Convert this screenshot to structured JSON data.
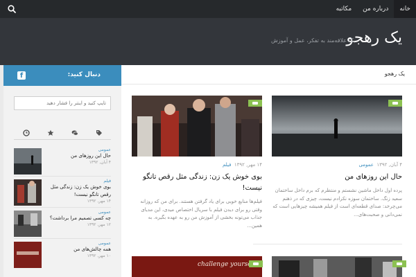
{
  "topnav": {
    "items": [
      {
        "label": "خانه"
      },
      {
        "label": "درباره من"
      },
      {
        "label": "مکاتبه"
      }
    ]
  },
  "header": {
    "title": "یک رهجو",
    "description": "یک علاقه‌مند به تفکر، عمل و آموزش"
  },
  "sidebar": {
    "follow_title": "دنبال کنید:",
    "search_placeholder": "تایپ کنید و اینتر را فشار دهید",
    "tabs": [
      "clock-icon",
      "star-icon",
      "comments-icon",
      "tags-icon"
    ],
    "items": [
      {
        "category": "عمومی",
        "title": "حال این روزهای من",
        "date": "۴ آبان, ۱۳۹۲"
      },
      {
        "category": "فیلم",
        "title": "بوی خوش یک زن: زندگی مثل رقص تانگو نیست!",
        "date": "۱۴ مهر, ۱۳۹۲"
      },
      {
        "category": "عمومی",
        "title": "چه کسی تصمیم مرا برداشت؟",
        "date": "۱۲ مهر, ۱۳۹۲"
      },
      {
        "category": "عمومی",
        "title": "همه چالش‌های من",
        "date": "۱۰ مهر, ۱۳۹۲"
      }
    ]
  },
  "main": {
    "breadcrumb": "یک رهجو",
    "posts": [
      {
        "date": "۴ آبان, ۱۳۹۲",
        "category": "عمومی",
        "title": "حال این روزهای من",
        "excerpt": "پرده اول داخل ماشین نشستم و منتظرم که برم داخل ساختمان سعید زنگ. ساختمان سوزه نکرادم نیست، چیزی که در ذهنم می‌چرخد: صدای قطعه‌ای است از فیلم همیشه چیزهایی است که نمی‌دانی و صحبت‌های..."
      },
      {
        "date": "۱۴ مهر, ۱۳۹۲",
        "category": "فیلم",
        "title": "بوی خوش یک زن: زندگی مثل رقص تانگو نیست!",
        "excerpt": "فیلم‌ها منابع خوبی برای یاد گرفتن هستند. برای من که روزانه وقتی رو برای دیدن فیلم با سریال اختصاص میدی، این مدیای جذاب می‌تونه بخشی از آموزش من رو به عهده بگیره. به همین..."
      },
      {
        "image_text": "challenge yourself"
      }
    ]
  }
}
